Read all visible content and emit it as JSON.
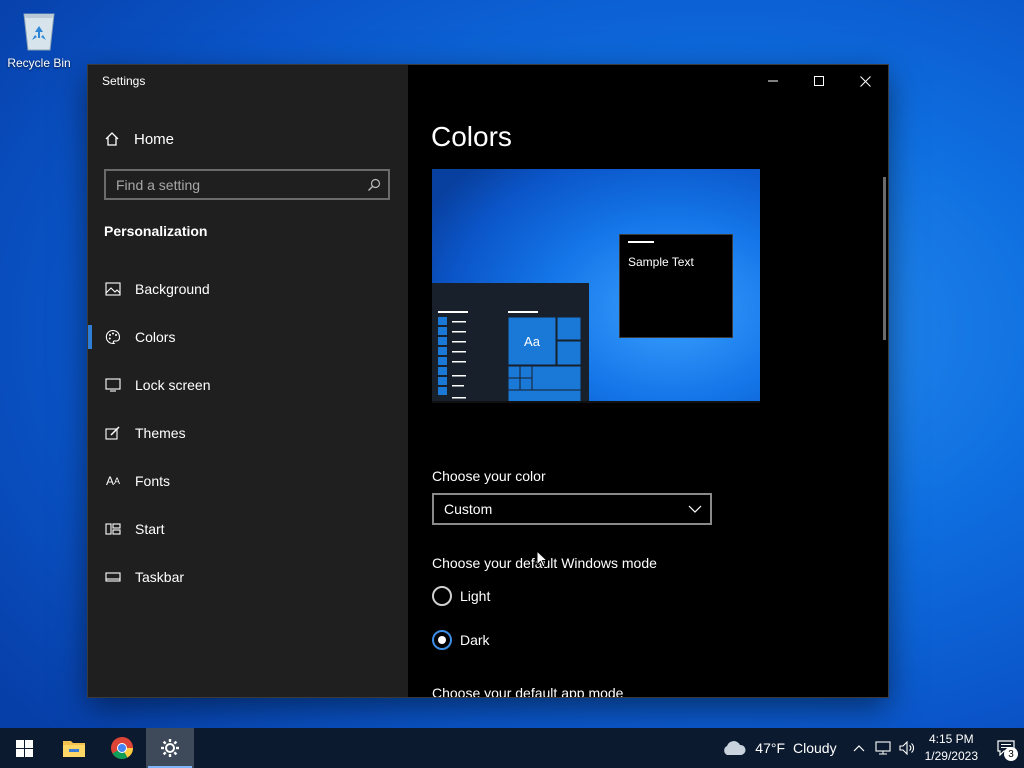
{
  "desktop": {
    "recycle_bin_label": "Recycle Bin"
  },
  "window": {
    "title": "Settings",
    "home_label": "Home",
    "search_placeholder": "Find a setting",
    "section_title": "Personalization",
    "nav_items": [
      {
        "label": "Background",
        "icon": "picture-icon"
      },
      {
        "label": "Colors",
        "icon": "palette-icon",
        "active": true
      },
      {
        "label": "Lock screen",
        "icon": "lock-screen-icon"
      },
      {
        "label": "Themes",
        "icon": "brush-icon"
      },
      {
        "label": "Fonts",
        "icon": "fonts-icon"
      },
      {
        "label": "Start",
        "icon": "start-icon"
      },
      {
        "label": "Taskbar",
        "icon": "taskbar-icon"
      }
    ]
  },
  "main": {
    "page_title": "Colors",
    "preview": {
      "sample_text": "Sample Text",
      "tile_text": "Aa"
    },
    "choose_color_label": "Choose your color",
    "color_dropdown_value": "Custom",
    "windows_mode_label": "Choose your default Windows mode",
    "windows_mode_options": [
      {
        "label": "Light",
        "selected": false
      },
      {
        "label": "Dark",
        "selected": true
      }
    ],
    "app_mode_label": "Choose your default app mode"
  },
  "taskbar": {
    "weather": {
      "temp": "47°F",
      "condition": "Cloudy"
    },
    "time": "4:15 PM",
    "date": "1/29/2023",
    "notification_count": "3"
  },
  "colors": {
    "accent": "#2d7fd7",
    "sidebar_bg": "#1f1f1f",
    "content_bg": "#000000",
    "taskbar_bg": "#0b1a2e"
  }
}
